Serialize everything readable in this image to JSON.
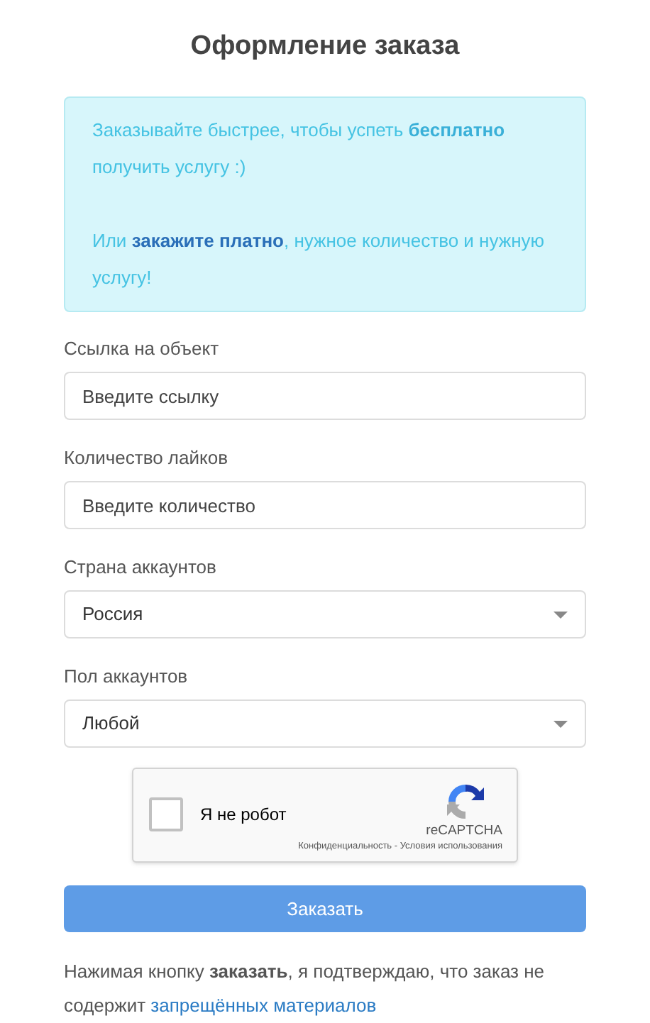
{
  "title": "Оформление заказа",
  "notice": {
    "paragraph_1": "Заказывайте быстрее, чтобы успеть **бесплатно** получить услугу :)",
    "paragraph_2": {
      "before": "Или ",
      "link": "закажите платно",
      "after": ", нужное количество и нужную услугу!"
    }
  },
  "fields": [
    {
      "kind": "input",
      "label": "Ссылка на объект",
      "placeholder": "Введите ссылку"
    },
    {
      "kind": "input",
      "label": "Количество лайков",
      "placeholder": "Введите количество"
    },
    {
      "kind": "select",
      "label": "Страна аккаунтов",
      "value": "Россия"
    },
    {
      "kind": "select",
      "label": "Пол аккаунтов",
      "value": "Любой"
    }
  ],
  "captcha": {
    "label": "Я не робот",
    "checked": false,
    "brand": "reCAPTCHA",
    "links": "Конфиденциальность - Условия использования"
  },
  "submit": "Заказать",
  "disclaimer": {
    "text": "Нажимая кнопку **заказать**, я подтверждаю, что заказ не содержит ",
    "link": "запрещённых материалов"
  }
}
